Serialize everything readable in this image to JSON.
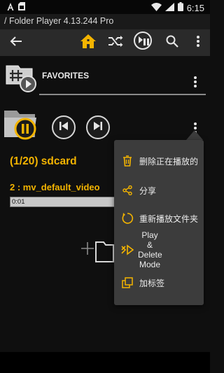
{
  "statusbar": {
    "time": "6:15",
    "left_icons": [
      "text-a-icon",
      "sim-card-icon"
    ],
    "right_icons": [
      "wifi-icon",
      "signal-icon",
      "battery-icon"
    ]
  },
  "app": {
    "title": "/ Folder Player 4.13.244  Pro"
  },
  "toolbar": {
    "icons": [
      "back-arrow-icon",
      "home-icon",
      "shuffle-icon",
      "play-pause-mode-icon",
      "search-icon",
      "overflow-menu-icon"
    ]
  },
  "favorites": {
    "label": "FAVORITES"
  },
  "player": {
    "folder_title": "(1/20)  sdcard",
    "track_title": "2 : mv_default_video",
    "elapsed": "0:01",
    "progress_fraction": 0.01
  },
  "popup_menu": {
    "items": [
      {
        "icon": "trash-icon",
        "label": "删除正在播放的"
      },
      {
        "icon": "share-icon",
        "label": "分享"
      },
      {
        "icon": "restart-icon",
        "label": "重新播放文件夹"
      },
      {
        "icon": "play-delete-icon",
        "label": "Play &\nDelete\nMode"
      },
      {
        "icon": "add-bookmark-icon",
        "label": "加标签"
      }
    ]
  },
  "colors": {
    "accent": "#f4b400",
    "background": "#0f0f0f",
    "toolbar": "#2a2a2a",
    "popup": "#3c3c3c"
  }
}
